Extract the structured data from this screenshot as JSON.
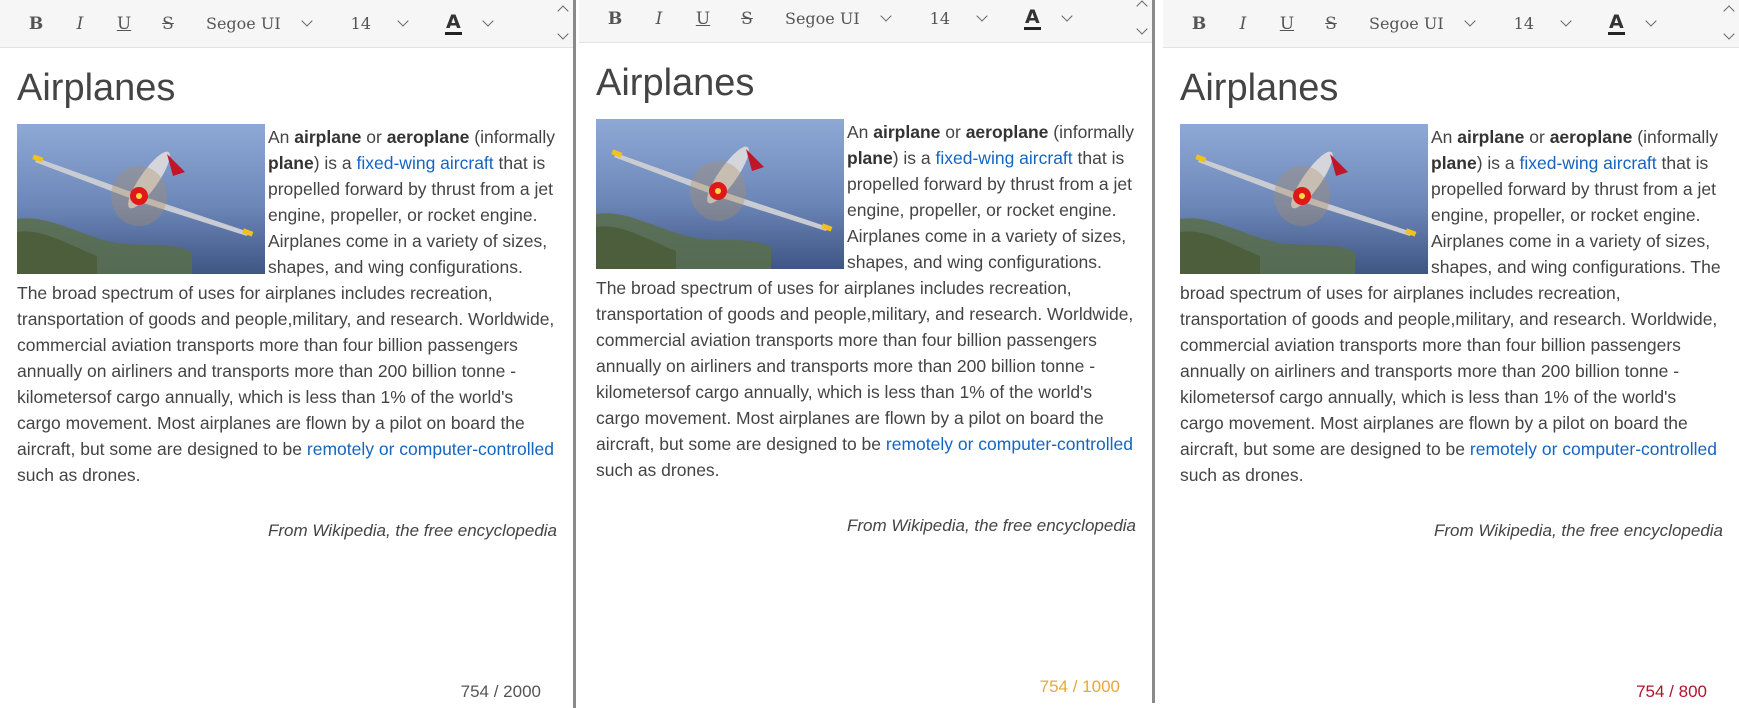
{
  "colors": {
    "counter_1": "#555555",
    "counter_2": "#e8a73a",
    "counter_3": "#b0152b",
    "link": "#1565c0"
  },
  "toolbar": {
    "bold": "B",
    "italic": "I",
    "underline": "U",
    "strike": "S",
    "font": "Segoe UI",
    "size": "14",
    "color_letter": "A"
  },
  "article": {
    "title": "Airplanes",
    "t1": "An ",
    "b1": "airplane",
    "t2": " or ",
    "b2": "aeroplane",
    "t3": " (informally ",
    "b3": "plane",
    "t4": ") is a ",
    "link1": "fixed-wing aircraft",
    "t5": " that is propelled forward by thrust from a jet engine, propeller, or rocket engine. Airplanes come in a variety of sizes, shapes, and wing configurations. The broad spectrum of uses for airplanes includes recreation, transportation of goods and people,military, and research. Worldwide, commercial aviation transports more than four billion passengers annually on airliners and transports more than 200 billion tonne -kilometersof cargo annually, which is less than 1% of the world's cargo movement. Most airplanes are flown by a pilot on board the aircraft, but some are designed to be ",
    "link2": "remotely or computer-controlled",
    "t6": " such as drones.",
    "source": "From Wikipedia, the free encyclopedia"
  },
  "editors": [
    {
      "counter": "754 / 2000"
    },
    {
      "counter": "754 / 1000"
    },
    {
      "counter": "754 / 800"
    }
  ]
}
